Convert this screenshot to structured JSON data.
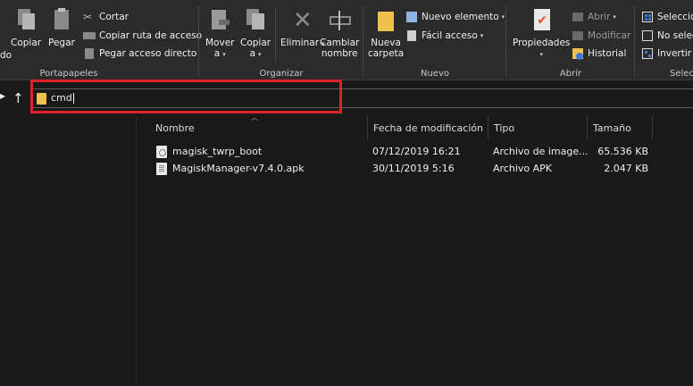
{
  "ribbon": {
    "portapapeles": {
      "label": "Portapapeles",
      "pin_label": "do",
      "copy_label": "Copiar",
      "paste_label": "Pegar",
      "cut_label": "Cortar",
      "copy_path_label": "Copiar ruta de acceso",
      "paste_shortcut_label": "Pegar acceso directo"
    },
    "organizar": {
      "label": "Organizar",
      "move_label_1": "Mover",
      "move_label_2": "a",
      "copy_to_label_1": "Copiar",
      "copy_to_label_2": "a",
      "delete_label": "Eliminar",
      "rename_label_1": "Cambiar",
      "rename_label_2": "nombre"
    },
    "nuevo": {
      "label": "Nuevo",
      "new_folder_label_1": "Nueva",
      "new_folder_label_2": "carpeta",
      "new_item_label": "Nuevo elemento",
      "easy_access_label": "Fácil acceso"
    },
    "abrir": {
      "label": "Abrir",
      "properties_label": "Propiedades",
      "open_label": "Abrir",
      "edit_label": "Modificar",
      "history_label": "Historial"
    },
    "seleccionar": {
      "label": "Selecc",
      "select_all_label": "Seleccio",
      "select_none_label": "No selec",
      "invert_label": "Invertir s"
    }
  },
  "addressbar": {
    "up_arrow": "↑",
    "value": "cmd"
  },
  "columns": {
    "name": "Nombre",
    "date": "Fecha de modificación",
    "type": "Tipo",
    "size": "Tamaño"
  },
  "files": [
    {
      "name": "magisk_twrp_boot",
      "date": "07/12/2019 16:21",
      "type": "Archivo de image...",
      "size": "65.536 KB"
    },
    {
      "name": "MagiskManager-v7.4.0.apk",
      "date": "30/11/2019 5:16",
      "type": "Archivo APK",
      "size": "2.047 KB"
    }
  ],
  "colors": {
    "highlight": "#e0202a",
    "folder": "#f0c14a",
    "background": "#191919",
    "ribbon": "#2b2b2b"
  }
}
